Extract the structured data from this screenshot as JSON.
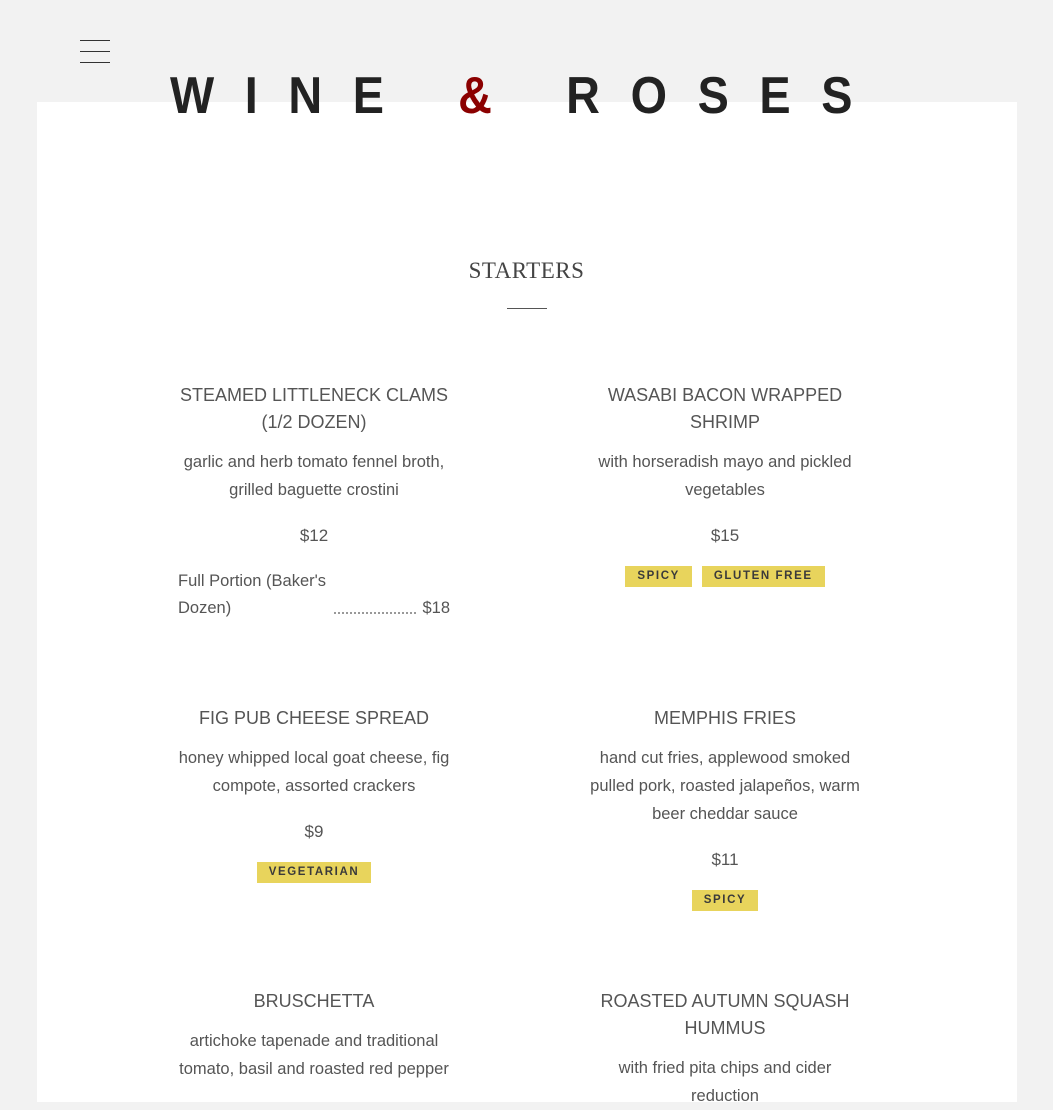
{
  "brand": {
    "word1": "WINE",
    "amp": "&",
    "word2": "ROSES"
  },
  "nav": {
    "menu_icon": "hamburger-icon"
  },
  "colors": {
    "accent": "#8b0000",
    "tag": "#e8d45c",
    "background": "#f2f2f2",
    "panel": "#ffffff"
  },
  "section": {
    "title": "STARTERS"
  },
  "items": [
    {
      "name": "STEAMED LITTLENECK CLAMS (1/2 DOZEN)",
      "desc": "garlic and herb tomato fennel broth, grilled baguette crostini",
      "price": "$12",
      "portion": {
        "label": "Full Portion (Baker's Dozen)",
        "price": "$18"
      },
      "tags": []
    },
    {
      "name": "WASABI BACON WRAPPED SHRIMP",
      "desc": "with horseradish mayo and pickled vegetables",
      "price": "$15",
      "tags": [
        "SPICY",
        "GLUTEN FREE"
      ]
    },
    {
      "name": "FIG PUB CHEESE SPREAD",
      "desc": "honey whipped local goat cheese, fig compote, assorted crackers",
      "price": "$9",
      "tags": [
        "VEGETARIAN"
      ]
    },
    {
      "name": "MEMPHIS FRIES",
      "desc": "hand cut fries, applewood smoked pulled pork, roasted jalapeños, warm beer cheddar sauce",
      "price": "$11",
      "tags": [
        "SPICY"
      ]
    },
    {
      "name": "BRUSCHETTA",
      "desc": "artichoke tapenade and traditional tomato, basil and roasted red pepper",
      "price": "",
      "tags": []
    },
    {
      "name": "ROASTED AUTUMN SQUASH HUMMUS",
      "desc": "with fried pita chips and cider reduction",
      "price": "",
      "tags": []
    }
  ]
}
